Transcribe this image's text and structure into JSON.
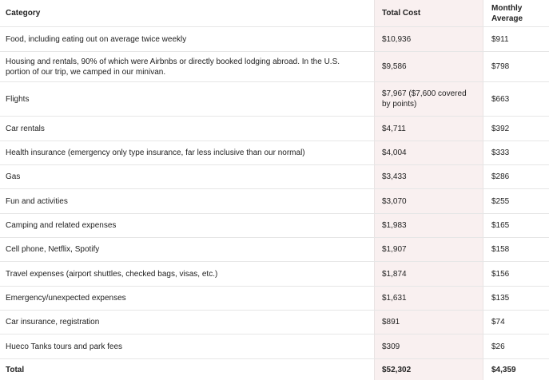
{
  "header": {
    "category": "Category",
    "total_cost": "Total Cost",
    "monthly_average": "Monthly Average"
  },
  "rows": [
    {
      "category": "Food, including eating out on average twice weekly",
      "total": "$10,936",
      "monthly": "$911"
    },
    {
      "category": "Housing and rentals, 90% of which were Airbnbs or directly booked lodging abroad. In the U.S. portion of our trip, we camped in our minivan.",
      "total": "$9,586",
      "monthly": "$798"
    },
    {
      "category": "Flights",
      "total": "$7,967 ($7,600 covered by points)",
      "monthly": "$663"
    },
    {
      "category": "Car rentals",
      "total": "$4,711",
      "monthly": "$392"
    },
    {
      "category": "Health insurance (emergency only type insurance, far less inclusive than our normal)",
      "total": "$4,004",
      "monthly": "$333"
    },
    {
      "category": "Gas",
      "total": "$3,433",
      "monthly": "$286"
    },
    {
      "category": "Fun and activities",
      "total": "$3,070",
      "monthly": "$255"
    },
    {
      "category": "Camping and related expenses",
      "total": "$1,983",
      "monthly": "$165"
    },
    {
      "category": "Cell phone, Netflix, Spotify",
      "total": "$1,907",
      "monthly": "$158"
    },
    {
      "category": "Travel expenses (airport shuttles, checked bags, visas, etc.)",
      "total": "$1,874",
      "monthly": "$156"
    },
    {
      "category": "Emergency/unexpected expenses",
      "total": "$1,631",
      "monthly": "$135"
    },
    {
      "category": "Car insurance, registration",
      "total": "$891",
      "monthly": "$74"
    },
    {
      "category": "Hueco Tanks tours and park fees",
      "total": "$309",
      "monthly": "$26"
    }
  ],
  "total": {
    "category": "Total",
    "total": "$52,302",
    "monthly": "$4,359"
  }
}
